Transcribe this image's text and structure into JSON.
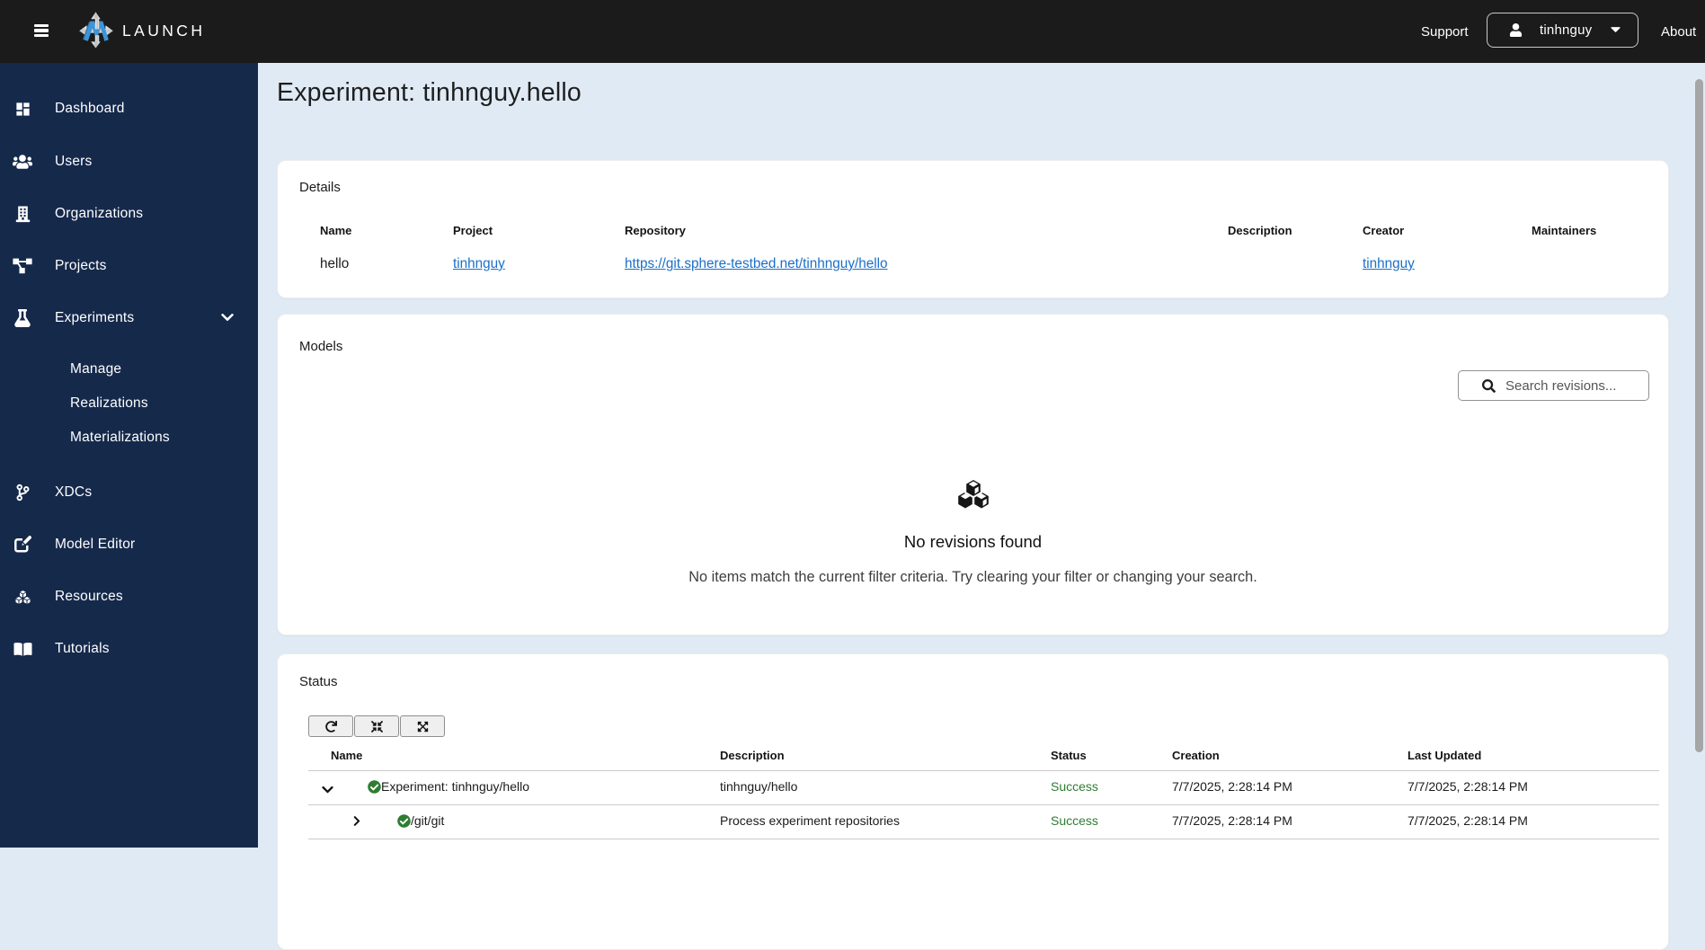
{
  "navbar": {
    "brand": "LAUNCH",
    "support_label": "Support",
    "username": "tinhnguy",
    "about_label": "About"
  },
  "sidebar": {
    "items": [
      {
        "label": "Dashboard"
      },
      {
        "label": "Users"
      },
      {
        "label": "Organizations"
      },
      {
        "label": "Projects"
      },
      {
        "label": "Experiments"
      },
      {
        "label": "Manage"
      },
      {
        "label": "Realizations"
      },
      {
        "label": "Materializations"
      },
      {
        "label": "XDCs"
      },
      {
        "label": "Model Editor"
      },
      {
        "label": "Resources"
      },
      {
        "label": "Tutorials"
      }
    ]
  },
  "page": {
    "title": "Experiment: tinhnguy.hello"
  },
  "details": {
    "title": "Details",
    "headers": [
      "Name",
      "Project",
      "Repository",
      "Description",
      "Creator",
      "Maintainers"
    ],
    "row": {
      "name": "hello",
      "project": "tinhnguy",
      "repository": "https://git.sphere-testbed.net/tinhnguy/hello",
      "description": "",
      "creator": "tinhnguy",
      "maintainers": ""
    }
  },
  "models": {
    "title": "Models",
    "search_placeholder": "Search revisions...",
    "empty_title": "No revisions found",
    "empty_message": "No items match the current filter criteria. Try clearing your filter or changing your search."
  },
  "status": {
    "title": "Status",
    "headers": [
      "Name",
      "Description",
      "Status",
      "Creation",
      "Last Updated"
    ],
    "rows": [
      {
        "name": "Experiment: tinhnguy/hello",
        "description": "tinhnguy/hello",
        "status": "Success",
        "creation": "7/7/2025, 2:28:14 PM",
        "last_updated": "7/7/2025, 2:28:14 PM"
      },
      {
        "name": "/git/git",
        "description": "Process experiment repositories",
        "status": "Success",
        "creation": "7/7/2025, 2:28:14 PM",
        "last_updated": "7/7/2025, 2:28:14 PM"
      }
    ]
  },
  "colors": {
    "navbar_bg": "#1b1b1b",
    "sidebar_bg": "#15294b",
    "page_bg": "#dfeaf5",
    "link": "#1a6fc9",
    "success": "#2e7d32",
    "logo_blue": "#3b8fd0"
  }
}
